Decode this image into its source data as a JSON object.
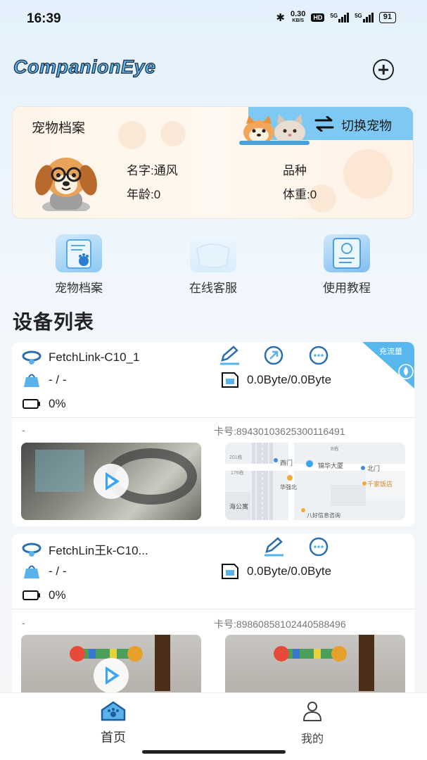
{
  "status_bar": {
    "time": "16:39",
    "net_speed": "0.30",
    "net_unit": "KB/S",
    "hd": "HD",
    "sig1": "5G",
    "sig2": "5G",
    "battery": "91"
  },
  "header": {
    "title": "CompanionEye"
  },
  "pet_card": {
    "title": "宠物档案",
    "switch_label": "切换宠物",
    "name": "名字:通风",
    "breed": "品种",
    "age": "年龄:0",
    "weight": "体重:0"
  },
  "quick_entries": [
    {
      "label": "宠物档案"
    },
    {
      "label": "在线客服"
    },
    {
      "label": "使用教程"
    }
  ],
  "section_title": "设备列表",
  "devices": [
    {
      "name": "FetchLink-C10_1",
      "location": "- / -",
      "battery": "0%",
      "data_usage": "0.0Byte/0.0Byte",
      "recharge_badge": "充流量",
      "dash": "-",
      "card_no": "卡号:89430103625300116491",
      "map_labels": [
        "锦华大厦",
        "西门",
        "北门",
        "千家饭店",
        "华强北",
        "海公寓",
        "八好信息咨询",
        "201栋",
        "176栋",
        "B栋"
      ]
    },
    {
      "name": "FetchLin王k-C10...",
      "location": "- / -",
      "battery": "0%",
      "data_usage": "0.0Byte/0.0Byte",
      "dash": "-",
      "card_no": "卡号:89860858102440588496"
    }
  ],
  "bottom_nav": {
    "home": "首页",
    "mine": "我的"
  },
  "colors": {
    "accent": "#5ab2ea",
    "switch_tab": "#7ec9f3",
    "play": "#3aa6f0"
  }
}
